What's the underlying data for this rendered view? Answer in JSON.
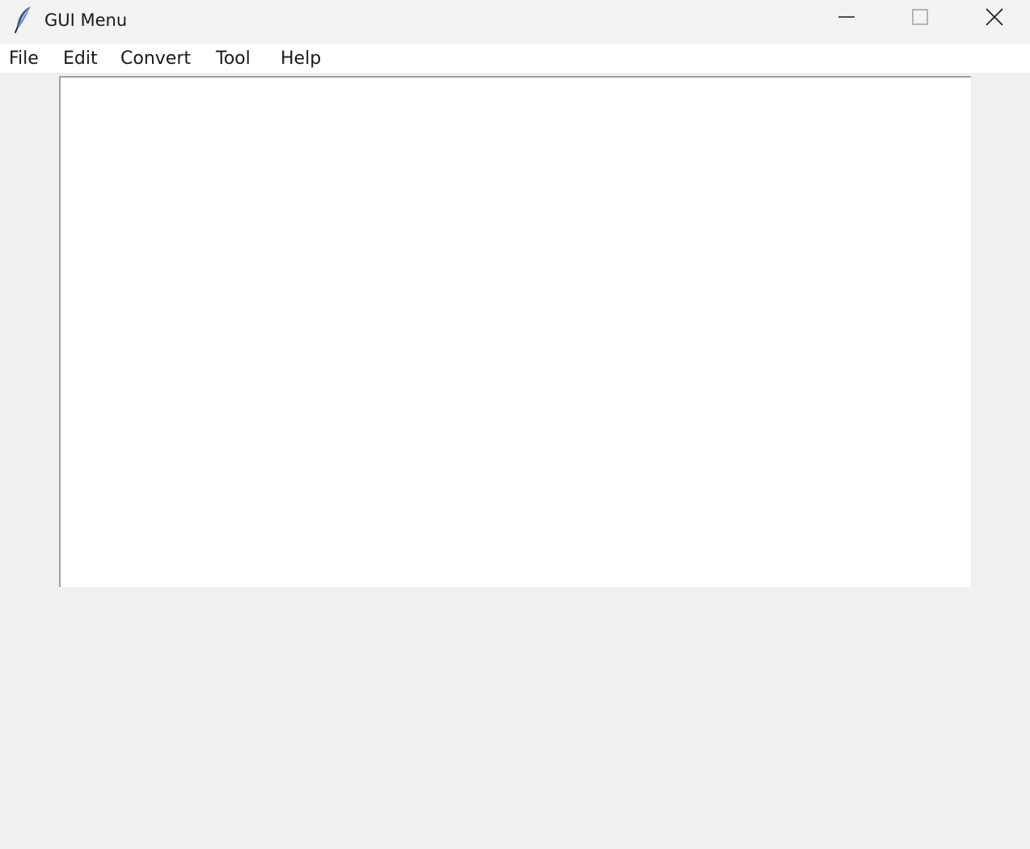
{
  "window": {
    "title": "GUI Menu",
    "controls": [
      "minimize-icon",
      "maximize-icon",
      "close-icon"
    ],
    "app_icon": "feather-icon"
  },
  "menubar": {
    "items": [
      {
        "label": "File"
      },
      {
        "label": "Edit"
      },
      {
        "label": "Convert"
      },
      {
        "label": "Tool"
      },
      {
        "label": "Help"
      }
    ]
  },
  "colors": {
    "titlebar": "#f3f3f3",
    "menubar": "#ffffff",
    "background": "#f0f0f0",
    "canvas": "#ffffff"
  }
}
